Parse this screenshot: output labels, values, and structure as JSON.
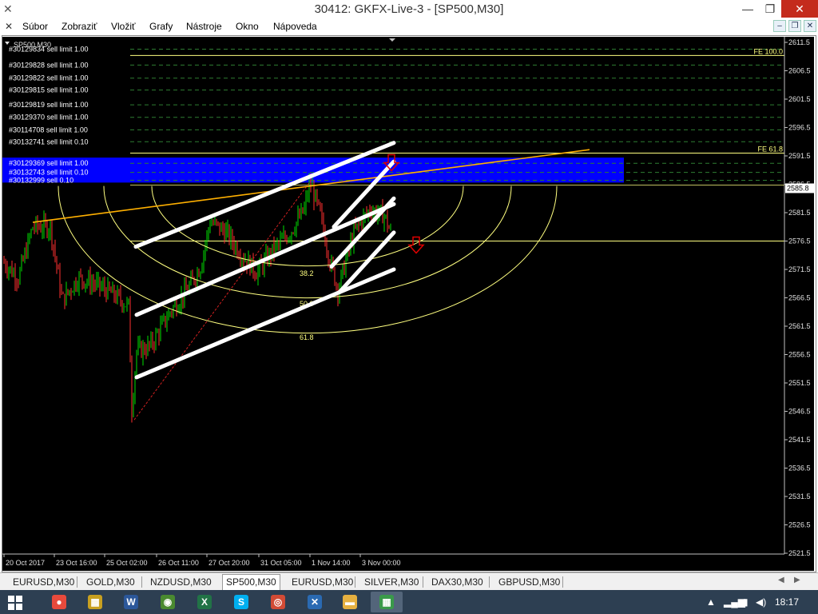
{
  "window": {
    "title": "30412: GKFX-Live-3 - [SP500,M30]",
    "minimize_glyph": "—",
    "maximize_glyph": "❐",
    "close_glyph": "✕"
  },
  "menu": {
    "items": [
      {
        "label": "Súbor"
      },
      {
        "label": "Zobraziť"
      },
      {
        "label": "Vložiť"
      },
      {
        "label": "Grafy"
      },
      {
        "label": "Nástroje"
      },
      {
        "label": "Okno"
      },
      {
        "label": "Nápoveda"
      }
    ],
    "mdi_minimize": "–",
    "mdi_restore": "❐",
    "mdi_close": "✕"
  },
  "chart": {
    "symbol_label": "SP500,M30",
    "current_price": "2585.8",
    "price_labels": [
      "2611.5",
      "2606.5",
      "2601.5",
      "2596.5",
      "2591.5",
      "2586.5",
      "2581.5",
      "2576.5",
      "2571.5",
      "2566.5",
      "2561.5",
      "2556.5",
      "2551.5",
      "2546.5",
      "2541.5",
      "2536.5",
      "2531.5",
      "2526.5",
      "2521.5"
    ],
    "time_labels": [
      "20 Oct 2017",
      "23 Oct 16:00",
      "25 Oct 02:00",
      "26 Oct 11:00",
      "27 Oct 20:00",
      "31 Oct 05:00",
      "1 Nov 14:00",
      "3 Nov 00:00"
    ],
    "orders": [
      {
        "label": "#30129834 sell limit 1.00",
        "price": 2610.3
      },
      {
        "label": "#30129828 sell limit 1.00",
        "price": 2607.5
      },
      {
        "label": "#30129822 sell limit 1.00",
        "price": 2605.2
      },
      {
        "label": "#30129815 sell limit 1.00",
        "price": 2603.1
      },
      {
        "label": "#30129819 sell limit 1.00",
        "price": 2600.5
      },
      {
        "label": "#30129370 sell limit 1.00",
        "price": 2598.3
      },
      {
        "label": "#30114708 sell limit 1.00",
        "price": 2596.1
      },
      {
        "label": "#30132741 sell limit 0.10",
        "price": 2594.0
      },
      {
        "label": "#30129369 sell limit 1.00",
        "price": 2590.2
      },
      {
        "label": "#30132743 sell limit 0.10",
        "price": 2588.6
      },
      {
        "label": "#30132999 sell 0.10",
        "price": 2587.2
      }
    ],
    "fibo_expansion": [
      {
        "label": "FE 100.0",
        "price": 2609.2
      },
      {
        "label": "FE 61.8",
        "price": 2592.0
      }
    ],
    "fibo_arcs": [
      {
        "label": "38.2"
      },
      {
        "label": "50.0"
      },
      {
        "label": "61.8"
      }
    ],
    "horizontal_line_price": 2576.5,
    "zone": {
      "top": 2591.2,
      "bottom": 2586.8
    },
    "colors": {
      "background": "#000000",
      "bull": "#00e000",
      "bear": "#ff3030",
      "order_line": "#2e7d32",
      "fibo": "#ffff80",
      "trendline": "#ffb000",
      "zone": "#0000ff",
      "arrow": "#e00000",
      "axis_text": "#e0e0e0",
      "drawing": "#ffffff"
    }
  },
  "tabs": [
    {
      "label": "EURUSD,M30"
    },
    {
      "label": "GOLD,M30"
    },
    {
      "label": "NZDUSD,M30"
    },
    {
      "label": "SP500,M30",
      "active": true
    },
    {
      "label": "EURUSD,M30"
    },
    {
      "label": "SILVER,M30"
    },
    {
      "label": "DAX30,M30"
    },
    {
      "label": "GBPUSD,M30"
    }
  ],
  "taskbar": {
    "apps": [
      {
        "icon": "paint-icon",
        "glyph": "●",
        "color": "#e84a3c"
      },
      {
        "icon": "excel-multi-icon",
        "glyph": "▦",
        "color": "#c8a020"
      },
      {
        "icon": "word-icon",
        "glyph": "W",
        "color": "#2b579a"
      },
      {
        "icon": "chrome-alt-icon",
        "glyph": "◉",
        "color": "#4a8a30"
      },
      {
        "icon": "excel-icon",
        "glyph": "X",
        "color": "#217346"
      },
      {
        "icon": "skype-icon",
        "glyph": "S",
        "color": "#00aff0"
      },
      {
        "icon": "chrome-icon",
        "glyph": "◎",
        "color": "#d24b35"
      },
      {
        "icon": "x-app-icon",
        "glyph": "✕",
        "color": "#2a6ab2"
      },
      {
        "icon": "folder-icon",
        "glyph": "▬",
        "color": "#e6b040"
      },
      {
        "icon": "metatrader-icon",
        "glyph": "▦",
        "color": "#3a9a4a",
        "active": true
      }
    ],
    "clock": "18:17"
  }
}
